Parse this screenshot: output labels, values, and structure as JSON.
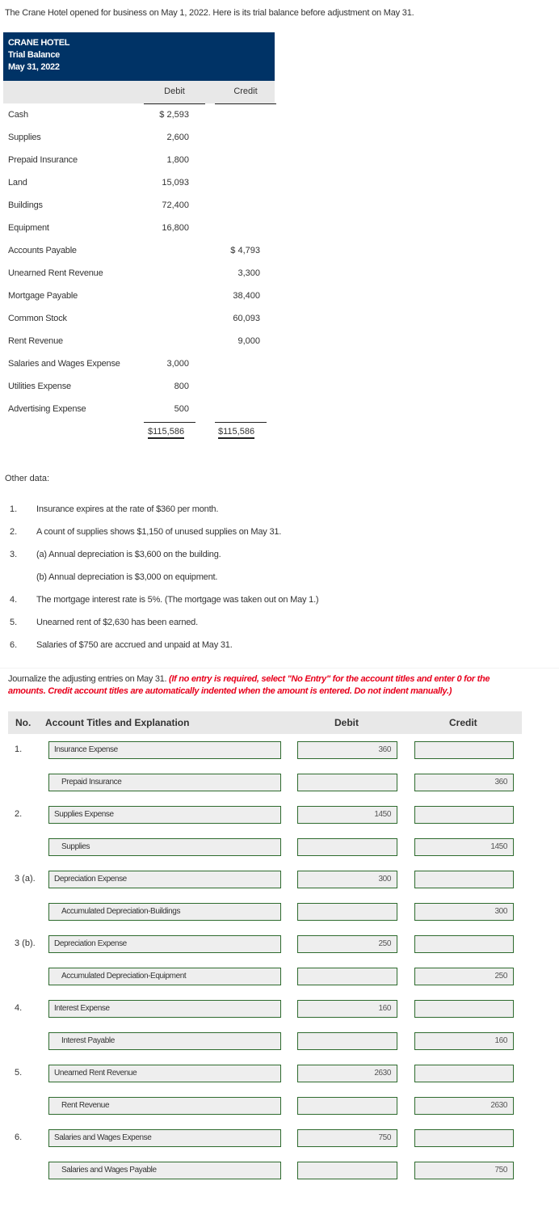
{
  "intro": "The Crane Hotel opened for business on May 1, 2022. Here is its trial balance before adjustment on May 31.",
  "trial_balance": {
    "company": "CRANE HOTEL",
    "title": "Trial Balance",
    "date": "May 31, 2022",
    "col_debit": "Debit",
    "col_credit": "Credit",
    "rows": [
      {
        "account": "Cash",
        "debit": "$ 2,593",
        "credit": ""
      },
      {
        "account": "Supplies",
        "debit": "2,600",
        "credit": ""
      },
      {
        "account": "Prepaid Insurance",
        "debit": "1,800",
        "credit": ""
      },
      {
        "account": "Land",
        "debit": "15,093",
        "credit": ""
      },
      {
        "account": "Buildings",
        "debit": "72,400",
        "credit": ""
      },
      {
        "account": "Equipment",
        "debit": "16,800",
        "credit": ""
      },
      {
        "account": "Accounts Payable",
        "debit": "",
        "credit": "$ 4,793"
      },
      {
        "account": "Unearned Rent Revenue",
        "debit": "",
        "credit": "3,300"
      },
      {
        "account": "Mortgage Payable",
        "debit": "",
        "credit": "38,400"
      },
      {
        "account": "Common Stock",
        "debit": "",
        "credit": "60,093"
      },
      {
        "account": "Rent Revenue",
        "debit": "",
        "credit": "9,000"
      },
      {
        "account": "Salaries and Wages Expense",
        "debit": "3,000",
        "credit": ""
      },
      {
        "account": "Utilities Expense",
        "debit": "800",
        "credit": ""
      },
      {
        "account": "Advertising Expense",
        "debit": "500",
        "credit": ""
      }
    ],
    "total_debit": "$115,586",
    "total_credit": "$115,586"
  },
  "other_data": {
    "label": "Other data:",
    "items": [
      {
        "num": "1.",
        "text": "Insurance expires at the rate of $360 per month."
      },
      {
        "num": "2.",
        "text": "A count of supplies shows $1,150 of unused supplies on May 31."
      },
      {
        "num": "3.",
        "text": "(a) Annual depreciation is $3,600 on the building."
      },
      {
        "num": "",
        "text": "(b) Annual depreciation is $3,000 on equipment."
      },
      {
        "num": "4.",
        "text": "The mortgage interest rate is 5%. (The mortgage was taken out on May 1.)"
      },
      {
        "num": "5.",
        "text": "Unearned rent of $2,630 has been earned."
      },
      {
        "num": "6.",
        "text": "Salaries of $750 are accrued and unpaid at May 31."
      }
    ]
  },
  "instructions": {
    "text": "Journalize the adjusting entries on May 31.",
    "note": "(If no entry is required, select \"No Entry\" for the account titles and enter 0 for the amounts. Credit account titles are automatically indented when the amount is entered. Do not indent manually.)",
    "note_color": "#e8001c"
  },
  "journal": {
    "headers": {
      "no": "No.",
      "account": "Account Titles and Explanation",
      "debit": "Debit",
      "credit": "Credit"
    },
    "rows": [
      {
        "no": "1.",
        "account": "Insurance Expense",
        "debit": "360",
        "credit": "",
        "indent": false
      },
      {
        "no": "",
        "account": "Prepaid Insurance",
        "debit": "",
        "credit": "360",
        "indent": true
      },
      {
        "no": "2.",
        "account": "Supplies Expense",
        "debit": "1450",
        "credit": "",
        "indent": false
      },
      {
        "no": "",
        "account": "Supplies",
        "debit": "",
        "credit": "1450",
        "indent": true
      },
      {
        "no": "3 (a).",
        "account": "Depreciation Expense",
        "debit": "300",
        "credit": "",
        "indent": false
      },
      {
        "no": "",
        "account": "Accumulated Depreciation-Buildings",
        "debit": "",
        "credit": "300",
        "indent": true
      },
      {
        "no": "3 (b).",
        "account": "Depreciation Expense",
        "debit": "250",
        "credit": "",
        "indent": false
      },
      {
        "no": "",
        "account": "Accumulated Depreciation-Equipment",
        "debit": "",
        "credit": "250",
        "indent": true
      },
      {
        "no": "4.",
        "account": "Interest Expense",
        "debit": "160",
        "credit": "",
        "indent": false
      },
      {
        "no": "",
        "account": "Interest Payable",
        "debit": "",
        "credit": "160",
        "indent": true
      },
      {
        "no": "5.",
        "account": "Unearned Rent Revenue",
        "debit": "2630",
        "credit": "",
        "indent": false
      },
      {
        "no": "",
        "account": "Rent Revenue",
        "debit": "",
        "credit": "2630",
        "indent": true
      },
      {
        "no": "6.",
        "account": "Salaries and Wages Expense",
        "debit": "750",
        "credit": "",
        "indent": false
      },
      {
        "no": "",
        "account": "Salaries and Wages Payable",
        "debit": "",
        "credit": "750",
        "indent": true
      }
    ]
  }
}
